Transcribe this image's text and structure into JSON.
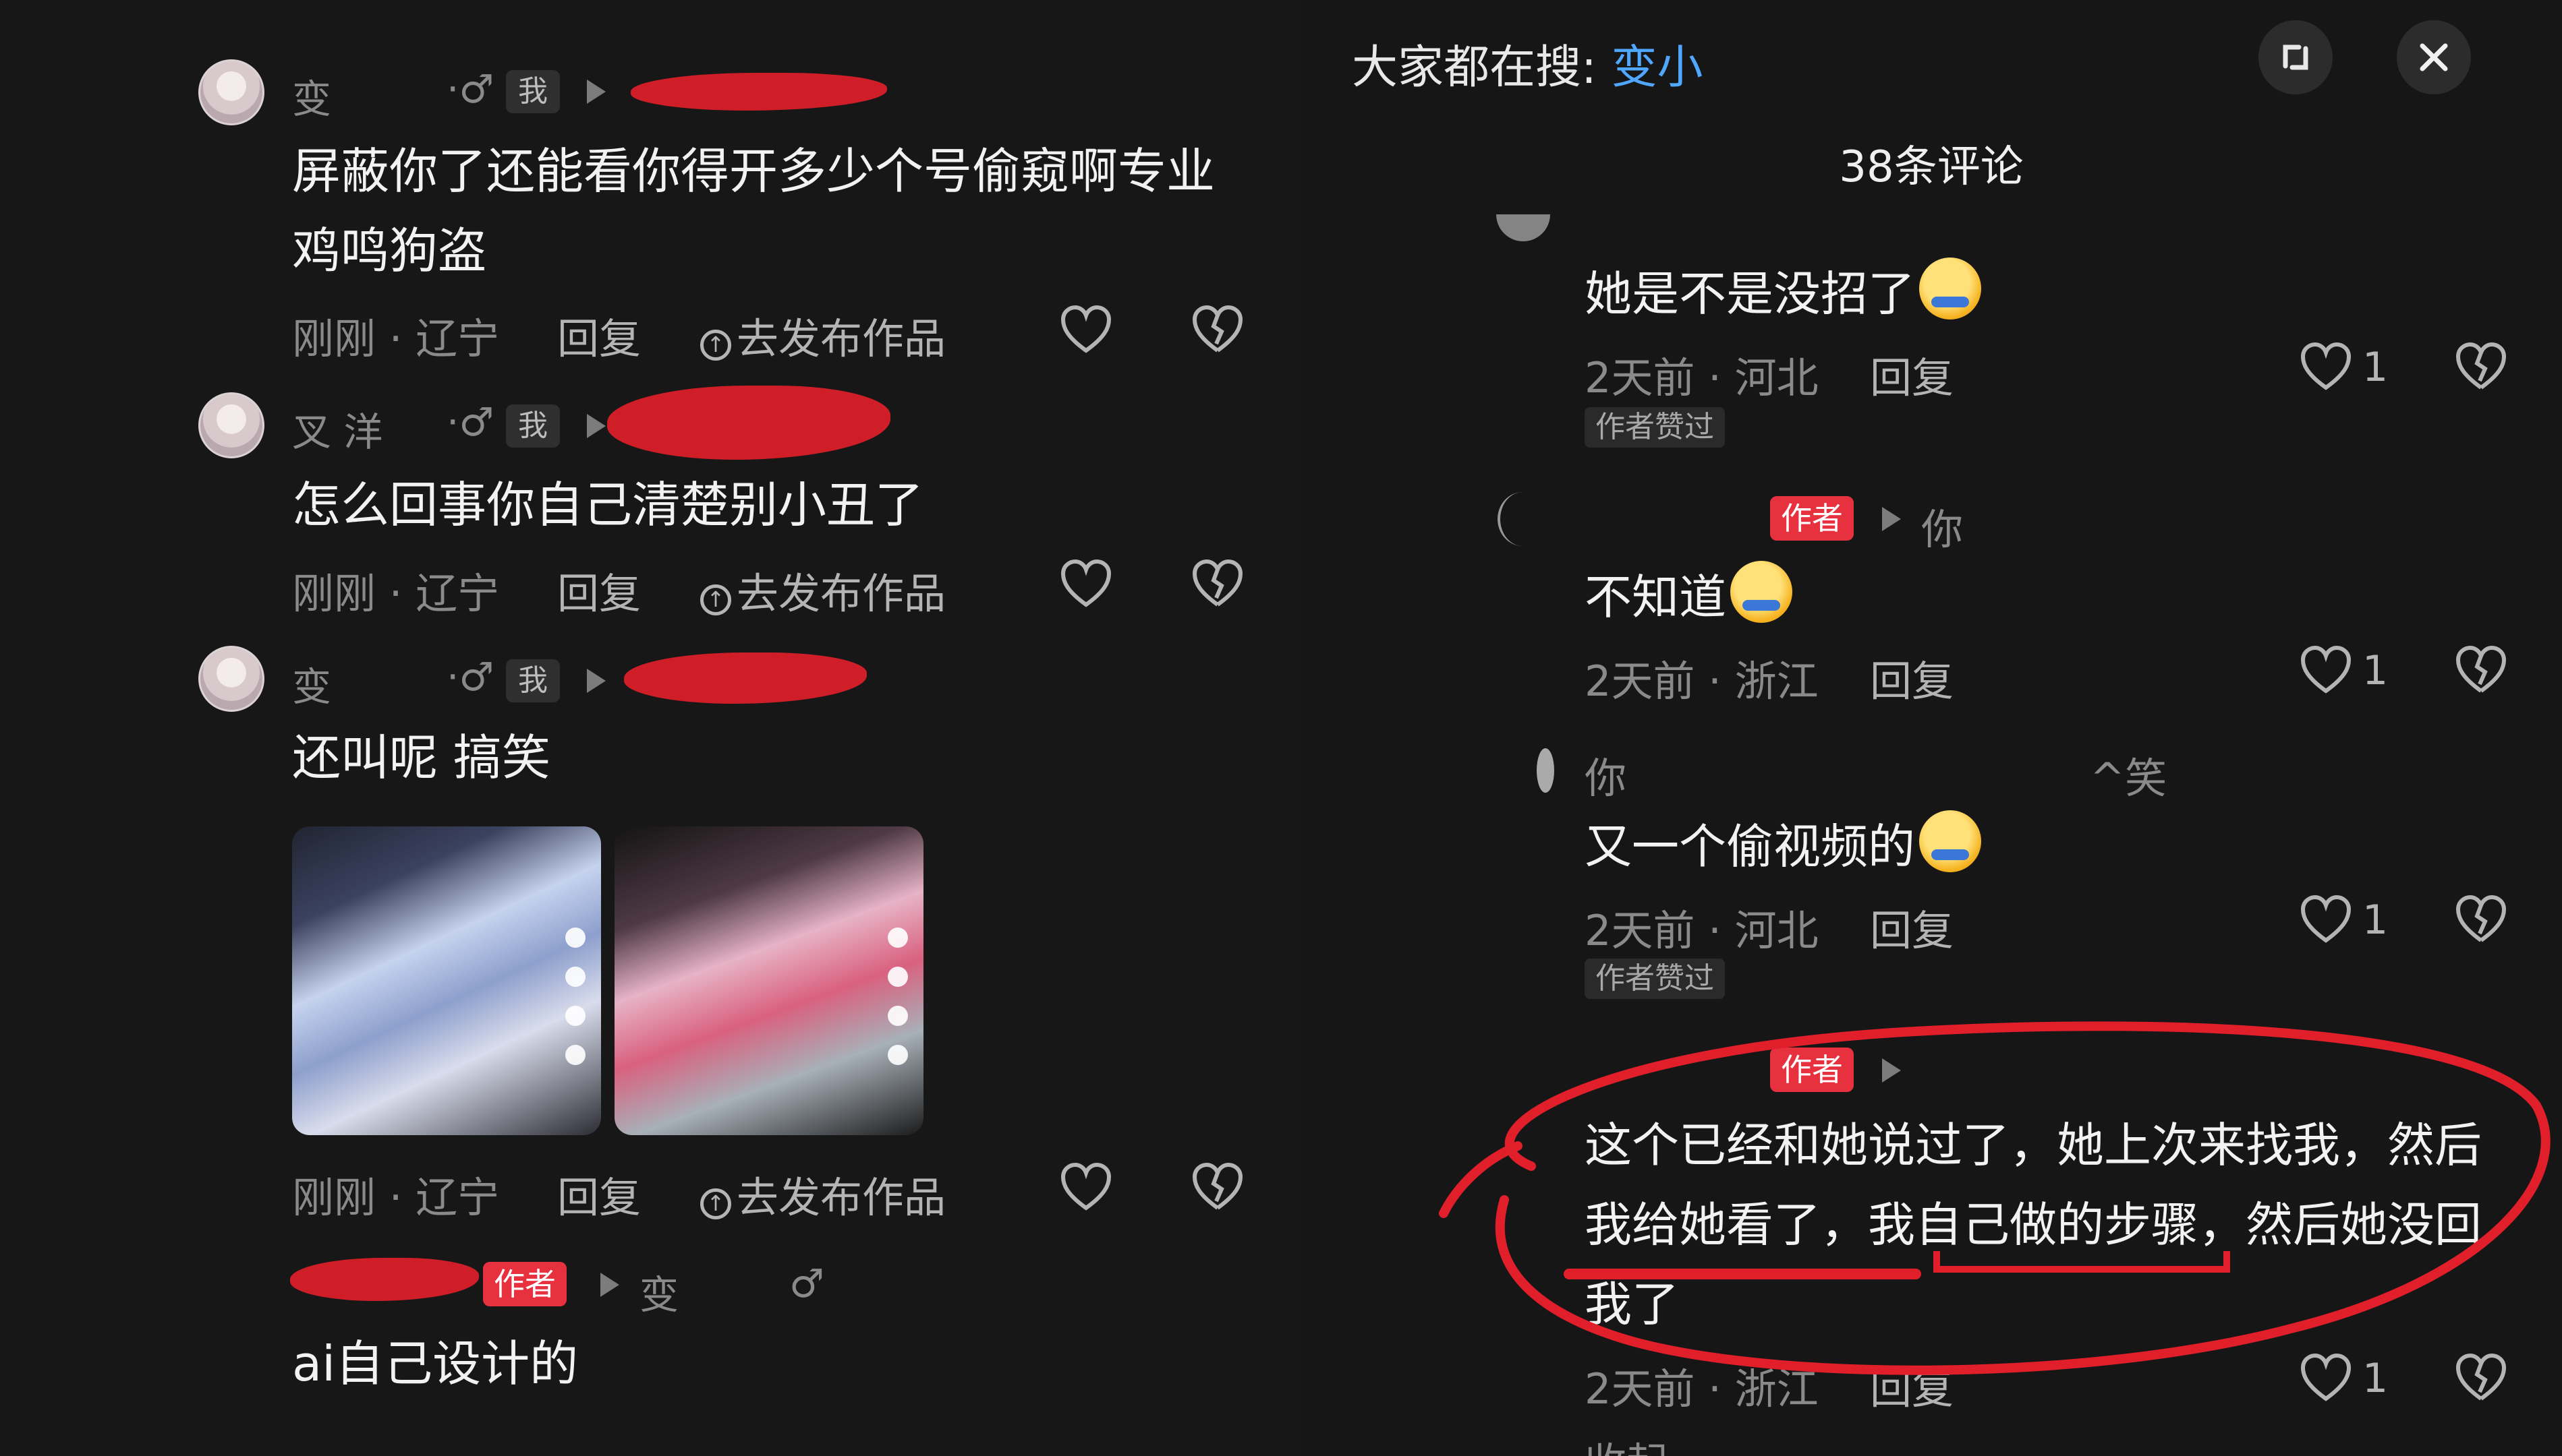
{
  "left_comments": [
    {
      "user": "变",
      "me_tag": "我",
      "text_lines": [
        "屏蔽你了还能看你得开多少个号偷窥啊专业",
        "鸡鸣狗盗"
      ],
      "time": "刚刚 · 辽宁",
      "reply": "回复",
      "publish": "去发布作品"
    },
    {
      "user": "叉 洋",
      "me_tag": "我",
      "text_lines": [
        "怎么回事你自己清楚别小丑了"
      ],
      "time": "刚刚 · 辽宁",
      "reply": "回复",
      "publish": "去发布作品"
    },
    {
      "user": "变",
      "me_tag": "我",
      "text_lines": [
        "还叫呢 搞笑"
      ],
      "time": "刚刚 · 辽宁",
      "reply": "回复",
      "publish": "去发布作品"
    },
    {
      "user": "",
      "author_tag": "作者",
      "reply_to": "变",
      "text_lines": [
        "ai自己设计的"
      ]
    }
  ],
  "right": {
    "search_prefix": "大家都在搜: ",
    "search_keyword": "变小",
    "comment_count": "38条评论",
    "comments": [
      {
        "text": "她是不是没招了",
        "time": "2天前 · 河北",
        "reply": "回复",
        "likes": "1",
        "badge": "作者赞过"
      },
      {
        "author_tag": "作者",
        "reply_to": "你",
        "text": "不知道",
        "time": "2天前 · 浙江",
        "reply": "回复",
        "likes": "1"
      },
      {
        "user": "你",
        "user_suffix": "^笑",
        "text": "又一个偷视频的",
        "time": "2天前 · 河北",
        "reply": "回复",
        "likes": "1",
        "badge": "作者赞过"
      },
      {
        "author_tag": "作者",
        "text_lines": [
          "这个已经和她说过了，她上次来找我，然后",
          "我给她看了，我自己做的步骤，然后她没回",
          "我了"
        ],
        "time": "2天前 · 浙江",
        "reply": "回复",
        "likes": "1"
      }
    ],
    "collapse": "收起"
  }
}
